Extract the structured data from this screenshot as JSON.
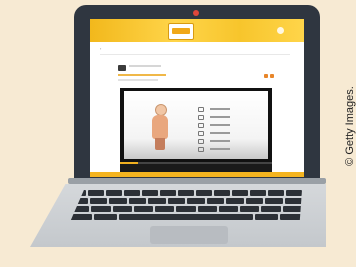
{
  "photo_credit": "© Getty Images.",
  "screen": {
    "header": {
      "logo_text": "",
      "brand_color": "#f2b81c"
    },
    "back_link_label": "",
    "top_right_link_label": "",
    "section_title": "",
    "video": {
      "progress": 0.12,
      "menu_items": [
        "",
        "",
        "",
        "",
        "",
        ""
      ]
    },
    "accent_color": "#e8862a"
  }
}
